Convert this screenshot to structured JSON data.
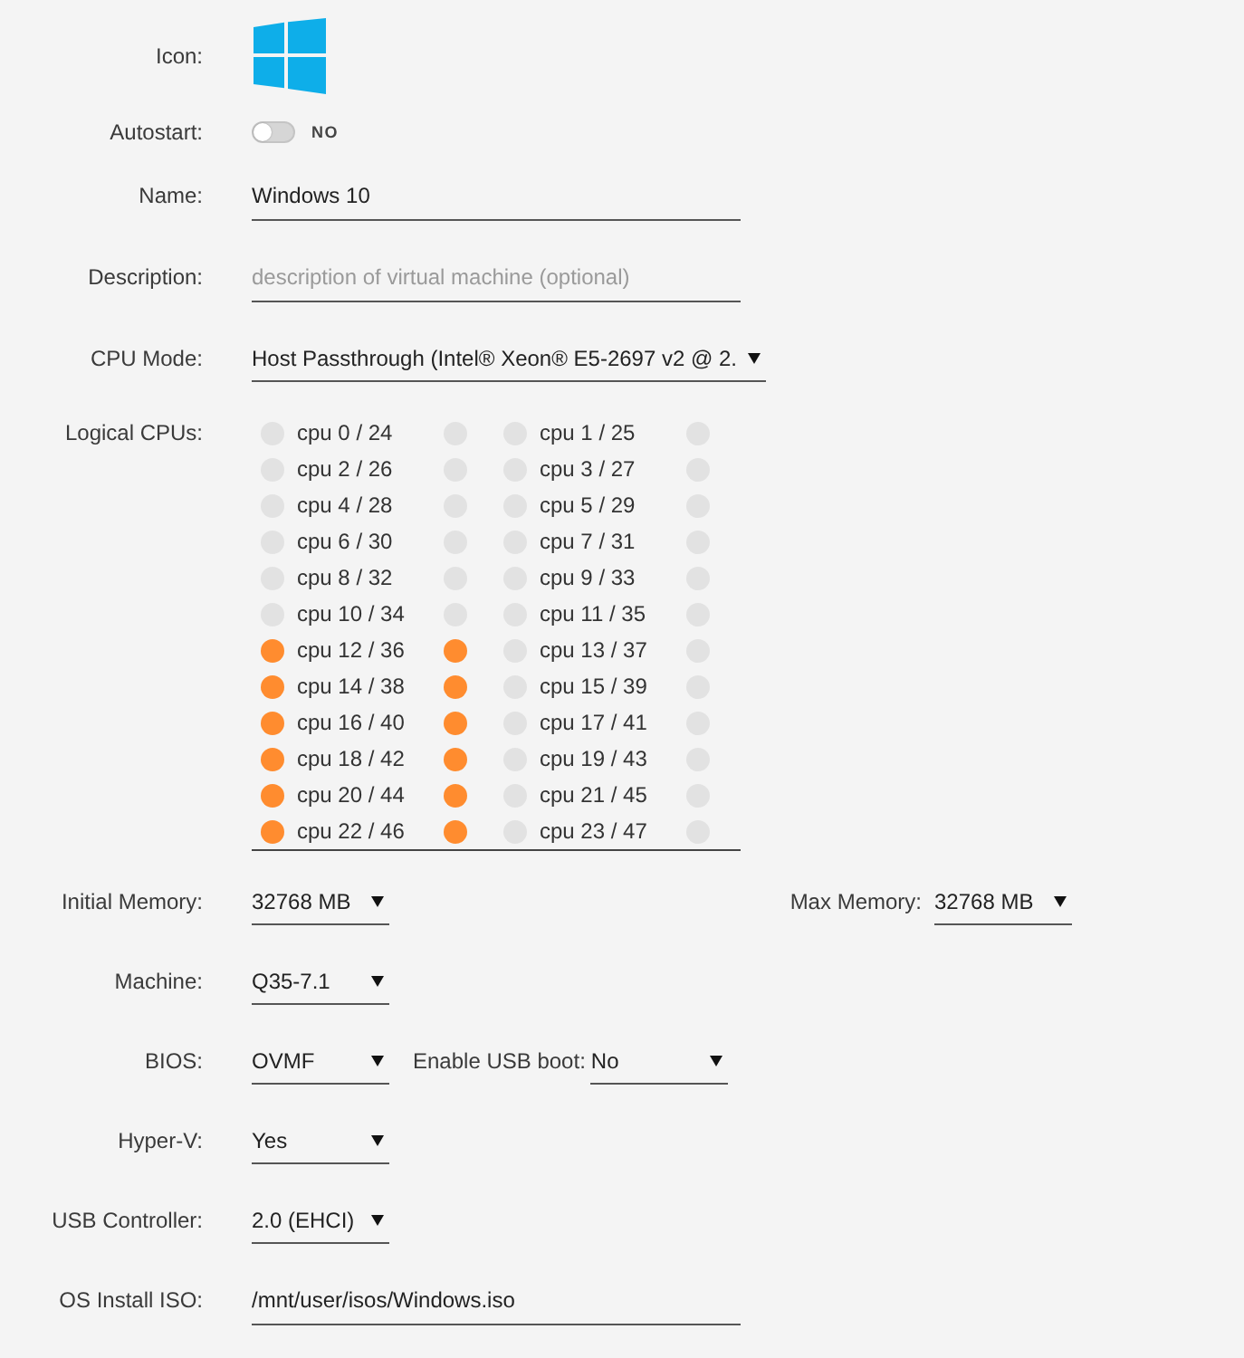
{
  "fields": [
    {
      "kind": "icon",
      "label": "Icon:"
    },
    {
      "kind": "toggle",
      "label": "Autostart:",
      "on": false,
      "state_text": "NO"
    },
    {
      "kind": "text",
      "label": "Name:",
      "value": "Windows 10"
    },
    {
      "kind": "text",
      "label": "Description:",
      "placeholder": "description of virtual machine (optional)"
    },
    {
      "kind": "select",
      "label": "CPU Mode:",
      "value": "Host Passthrough (Intel® Xeon® E5-2697 v2 @ 2."
    },
    {
      "kind": "cpus",
      "label": "Logical CPUs:",
      "cpus": [
        {
          "label": "cpu 0 / 24",
          "threads": [
            {
              "checked": false
            },
            {
              "checked": false
            }
          ]
        },
        {
          "label": "cpu 1 / 25",
          "threads": [
            {
              "checked": false
            },
            {
              "checked": false
            }
          ]
        },
        {
          "label": "cpu 2 / 26",
          "threads": [
            {
              "checked": false
            },
            {
              "checked": false
            }
          ]
        },
        {
          "label": "cpu 3 / 27",
          "threads": [
            {
              "checked": false
            },
            {
              "checked": false
            }
          ]
        },
        {
          "label": "cpu 4 / 28",
          "threads": [
            {
              "checked": false
            },
            {
              "checked": false
            }
          ]
        },
        {
          "label": "cpu 5 / 29",
          "threads": [
            {
              "checked": false
            },
            {
              "checked": false
            }
          ]
        },
        {
          "label": "cpu 6 / 30",
          "threads": [
            {
              "checked": false
            },
            {
              "checked": false
            }
          ]
        },
        {
          "label": "cpu 7 / 31",
          "threads": [
            {
              "checked": false
            },
            {
              "checked": false
            }
          ]
        },
        {
          "label": "cpu 8 / 32",
          "threads": [
            {
              "checked": false
            },
            {
              "checked": false
            }
          ]
        },
        {
          "label": "cpu 9 / 33",
          "threads": [
            {
              "checked": false
            },
            {
              "checked": false
            }
          ]
        },
        {
          "label": "cpu 10 / 34",
          "threads": [
            {
              "checked": false
            },
            {
              "checked": false
            }
          ]
        },
        {
          "label": "cpu 11 / 35",
          "threads": [
            {
              "checked": false
            },
            {
              "checked": false
            }
          ]
        },
        {
          "label": "cpu 12 / 36",
          "threads": [
            {
              "checked": true
            },
            {
              "checked": true
            }
          ]
        },
        {
          "label": "cpu 13 / 37",
          "threads": [
            {
              "checked": false
            },
            {
              "checked": false
            }
          ]
        },
        {
          "label": "cpu 14 / 38",
          "threads": [
            {
              "checked": true
            },
            {
              "checked": true
            }
          ]
        },
        {
          "label": "cpu 15 / 39",
          "threads": [
            {
              "checked": false
            },
            {
              "checked": false
            }
          ]
        },
        {
          "label": "cpu 16 / 40",
          "threads": [
            {
              "checked": true
            },
            {
              "checked": true
            }
          ]
        },
        {
          "label": "cpu 17 / 41",
          "threads": [
            {
              "checked": false
            },
            {
              "checked": false
            }
          ]
        },
        {
          "label": "cpu 18 / 42",
          "threads": [
            {
              "checked": true
            },
            {
              "checked": true
            }
          ]
        },
        {
          "label": "cpu 19 / 43",
          "threads": [
            {
              "checked": false
            },
            {
              "checked": false
            }
          ]
        },
        {
          "label": "cpu 20 / 44",
          "threads": [
            {
              "checked": true
            },
            {
              "checked": true
            }
          ]
        },
        {
          "label": "cpu 21 / 45",
          "threads": [
            {
              "checked": false
            },
            {
              "checked": false
            }
          ]
        },
        {
          "label": "cpu 22 / 46",
          "threads": [
            {
              "checked": true
            },
            {
              "checked": true
            }
          ]
        },
        {
          "label": "cpu 23 / 47",
          "threads": [
            {
              "checked": false
            },
            {
              "checked": false
            }
          ]
        }
      ]
    },
    {
      "kind": "memory",
      "label": "Initial Memory:",
      "value": "32768 MB",
      "second": {
        "label": "Max Memory:",
        "value": "32768 MB"
      }
    },
    {
      "kind": "select",
      "label": "Machine:",
      "value": "Q35-7.1"
    },
    {
      "kind": "pair",
      "label": "BIOS:",
      "value": "OVMF",
      "second": {
        "label": "Enable USB boot:",
        "value": "No"
      }
    },
    {
      "kind": "select",
      "label": "Hyper-V:",
      "value": "Yes"
    },
    {
      "kind": "select",
      "label": "USB Controller:",
      "value": "2.0 (EHCI)"
    },
    {
      "kind": "text",
      "label": "OS Install ISO:",
      "value": "/mnt/user/isos/Windows.iso"
    }
  ]
}
